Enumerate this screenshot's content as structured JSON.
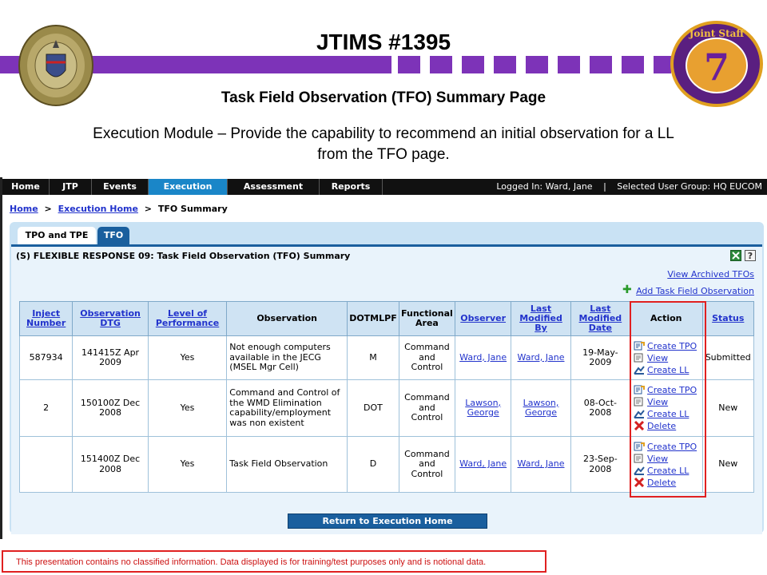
{
  "slide": {
    "title": "JTIMS #1395",
    "subtitle": "Task Field Observation (TFO) Summary Page",
    "description": "Execution Module – Provide the capability to recommend an initial observation for a LL from the TFO page.",
    "right_seal_text": "Joint Staff",
    "right_seal_number": "7",
    "disclaimer": "This presentation contains no classified information.  Data displayed is for training/test purposes only and is notional data."
  },
  "colors": {
    "accent_purple": "#7d33b8",
    "nav_active": "#1a86c8",
    "panel_blue": "#1a5f9e",
    "highlight_red": "#e02020"
  },
  "nav": {
    "tabs": [
      "Home",
      "JTP",
      "Events",
      "Execution",
      "Assessment",
      "Reports"
    ],
    "active": "Execution",
    "logged_in": "Logged In: Ward, Jane",
    "separator": "|",
    "user_group": "Selected User Group: HQ EUCOM"
  },
  "breadcrumb": {
    "home": "Home",
    "execution_home": "Execution Home",
    "current": "TFO Summary",
    "sep": ">"
  },
  "panel": {
    "tabs": [
      "TPO and TPE",
      "TFO"
    ],
    "summary_title": "(S) FLEXIBLE RESPONSE 09: Task Field Observation (TFO) Summary",
    "view_archived": "View Archived TFOs",
    "add_tfo": "Add Task Field Observation",
    "excel_icon": "excel-icon",
    "help_icon": "help-icon"
  },
  "table": {
    "headers": [
      "Inject Number",
      "Observation DTG",
      "Level of Performance",
      "Observation",
      "DOTMLPF",
      "Functional Area",
      "Observer",
      "Last Modified By",
      "Last Modified Date",
      "Action",
      "Status"
    ],
    "rows": [
      {
        "inject": "587934",
        "dtg": "141415Z Apr 2009",
        "level": "Yes",
        "observation": "Not enough computers available in the JECG (MSEL Mgr Cell)",
        "dotmlpf": "M",
        "area": "Command and Control",
        "observer": "Ward, Jane",
        "modified_by": "Ward, Jane",
        "modified_date": "19-May-2009",
        "actions": [
          "Create TPO",
          "View",
          "Create LL"
        ],
        "status": "Submitted"
      },
      {
        "inject": "2",
        "dtg": "150100Z Dec 2008",
        "level": "Yes",
        "observation": "Command and Control of the WMD Elimination capability/employment was non existent",
        "dotmlpf": "DOT",
        "area": "Command and Control",
        "observer": "Lawson, George",
        "modified_by": "Lawson, George",
        "modified_date": "08-Oct-2008",
        "actions": [
          "Create TPO",
          "View",
          "Create LL",
          "Delete"
        ],
        "status": "New"
      },
      {
        "inject": "",
        "dtg": "151400Z Dec 2008",
        "level": "Yes",
        "observation": "Task Field Observation",
        "dotmlpf": "D",
        "area": "Command and Control",
        "observer": "Ward, Jane",
        "modified_by": "Ward, Jane",
        "modified_date": "23-Sep-2008",
        "actions": [
          "Create TPO",
          "View",
          "Create LL",
          "Delete"
        ],
        "status": "New"
      }
    ]
  },
  "return_button": "Return to Execution Home"
}
